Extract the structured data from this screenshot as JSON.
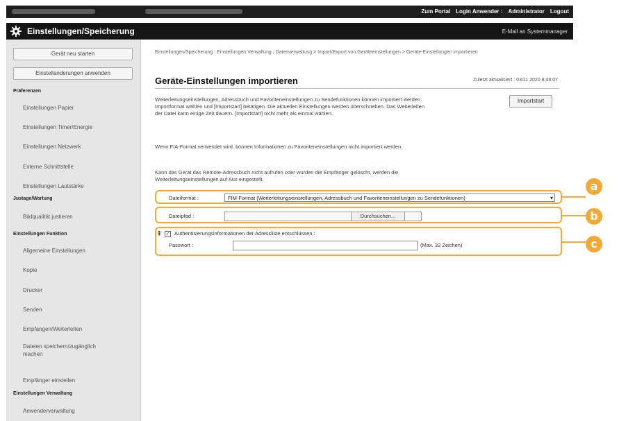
{
  "topbar": {
    "links": [
      "Zum Portal",
      "Login Anwender :",
      "Administrator",
      "Logout"
    ]
  },
  "titlebar": {
    "title": "Einstellungen/Speicherung",
    "mail": "E-Mail an Systemmanager",
    "icon": "gear-icon"
  },
  "sidebar": {
    "buttons": [
      "Gerät neu starten",
      "Einstellanderungen anwenden"
    ],
    "sections": [
      {
        "heading": "Präferenzen",
        "items": [
          "Einstellungen Papier",
          "Einstellungen Timer/Energie",
          "Einstellungen Netzwerk",
          "Externe Schnittstelle",
          "Einstellungen Lautstärke"
        ]
      },
      {
        "heading": "Justage/Wartung",
        "items": [
          "Bildqualität justieren"
        ]
      },
      {
        "heading": "Einstellungen Funktion",
        "items": [
          "Allgemeine Einstellungen",
          "Kopie",
          "Drucker",
          "Senden",
          "Empfangen/Weiterleiten",
          "Dateien speichern/zugänglich machen",
          "Empfänger einstellen"
        ]
      },
      {
        "heading": "Einstellungen Verwaltung",
        "items": [
          "Anwenderverwaltung"
        ]
      }
    ]
  },
  "main": {
    "breadcrumb": "Einstellungen/Speicherung : Einstellungen Verwaltung : Datenverwaltung > Import/Export von Geräteeinstellungen > Geräte-Einstellungen importieren",
    "title": "Geräte-Einstellungen importieren",
    "updated": "Zuletzt aktualisiert : 03/11 2020 8:48:07",
    "import_button": "Importstart",
    "para1": "Weiterleitungseinstellungen, Adressbuch und Favoriteneinstellungen zu Sendefunktionen können importiert werden. Importformat wählen und [Importstart] betätigen. Die aktuellen Einstellungen werden überschrieben. Das Weiterleiten der Datei kann einige Zeit dauern. [Importstart] nicht mehr als einmal wählen.",
    "para2": "Wenn FIA-Format verwendet wird, können Informationen zu Favoriteneinstellungen nicht importiert werden.",
    "para3": "Kann das Gerät das Remote-Adressbuch nicht aufrufen oder wurden die Empfänger gelöscht, werden die Weiterleitungseinstellungen auf Aus eingestellt.",
    "file_format_label": "Dateiformat :",
    "file_format_value": "FIM-Format (Weiterleitungseinstellungen, Adressbuch und Favoriteneinstellungen zu Sendefunktionen)",
    "file_path_label": "Dateipfad :",
    "browse_button": "Durchsuchen...",
    "auth_checkbox_label": "Authentisierungsinformationen der Adressliste entschlüssen :",
    "password_label": "Passwort :",
    "password_hint": "(Max. 32 Zeichen)",
    "top_arrow": "⇞"
  },
  "callouts": [
    "a",
    "b",
    "c"
  ],
  "colors": {
    "accent": "#f3a935",
    "dark": "#151515"
  }
}
